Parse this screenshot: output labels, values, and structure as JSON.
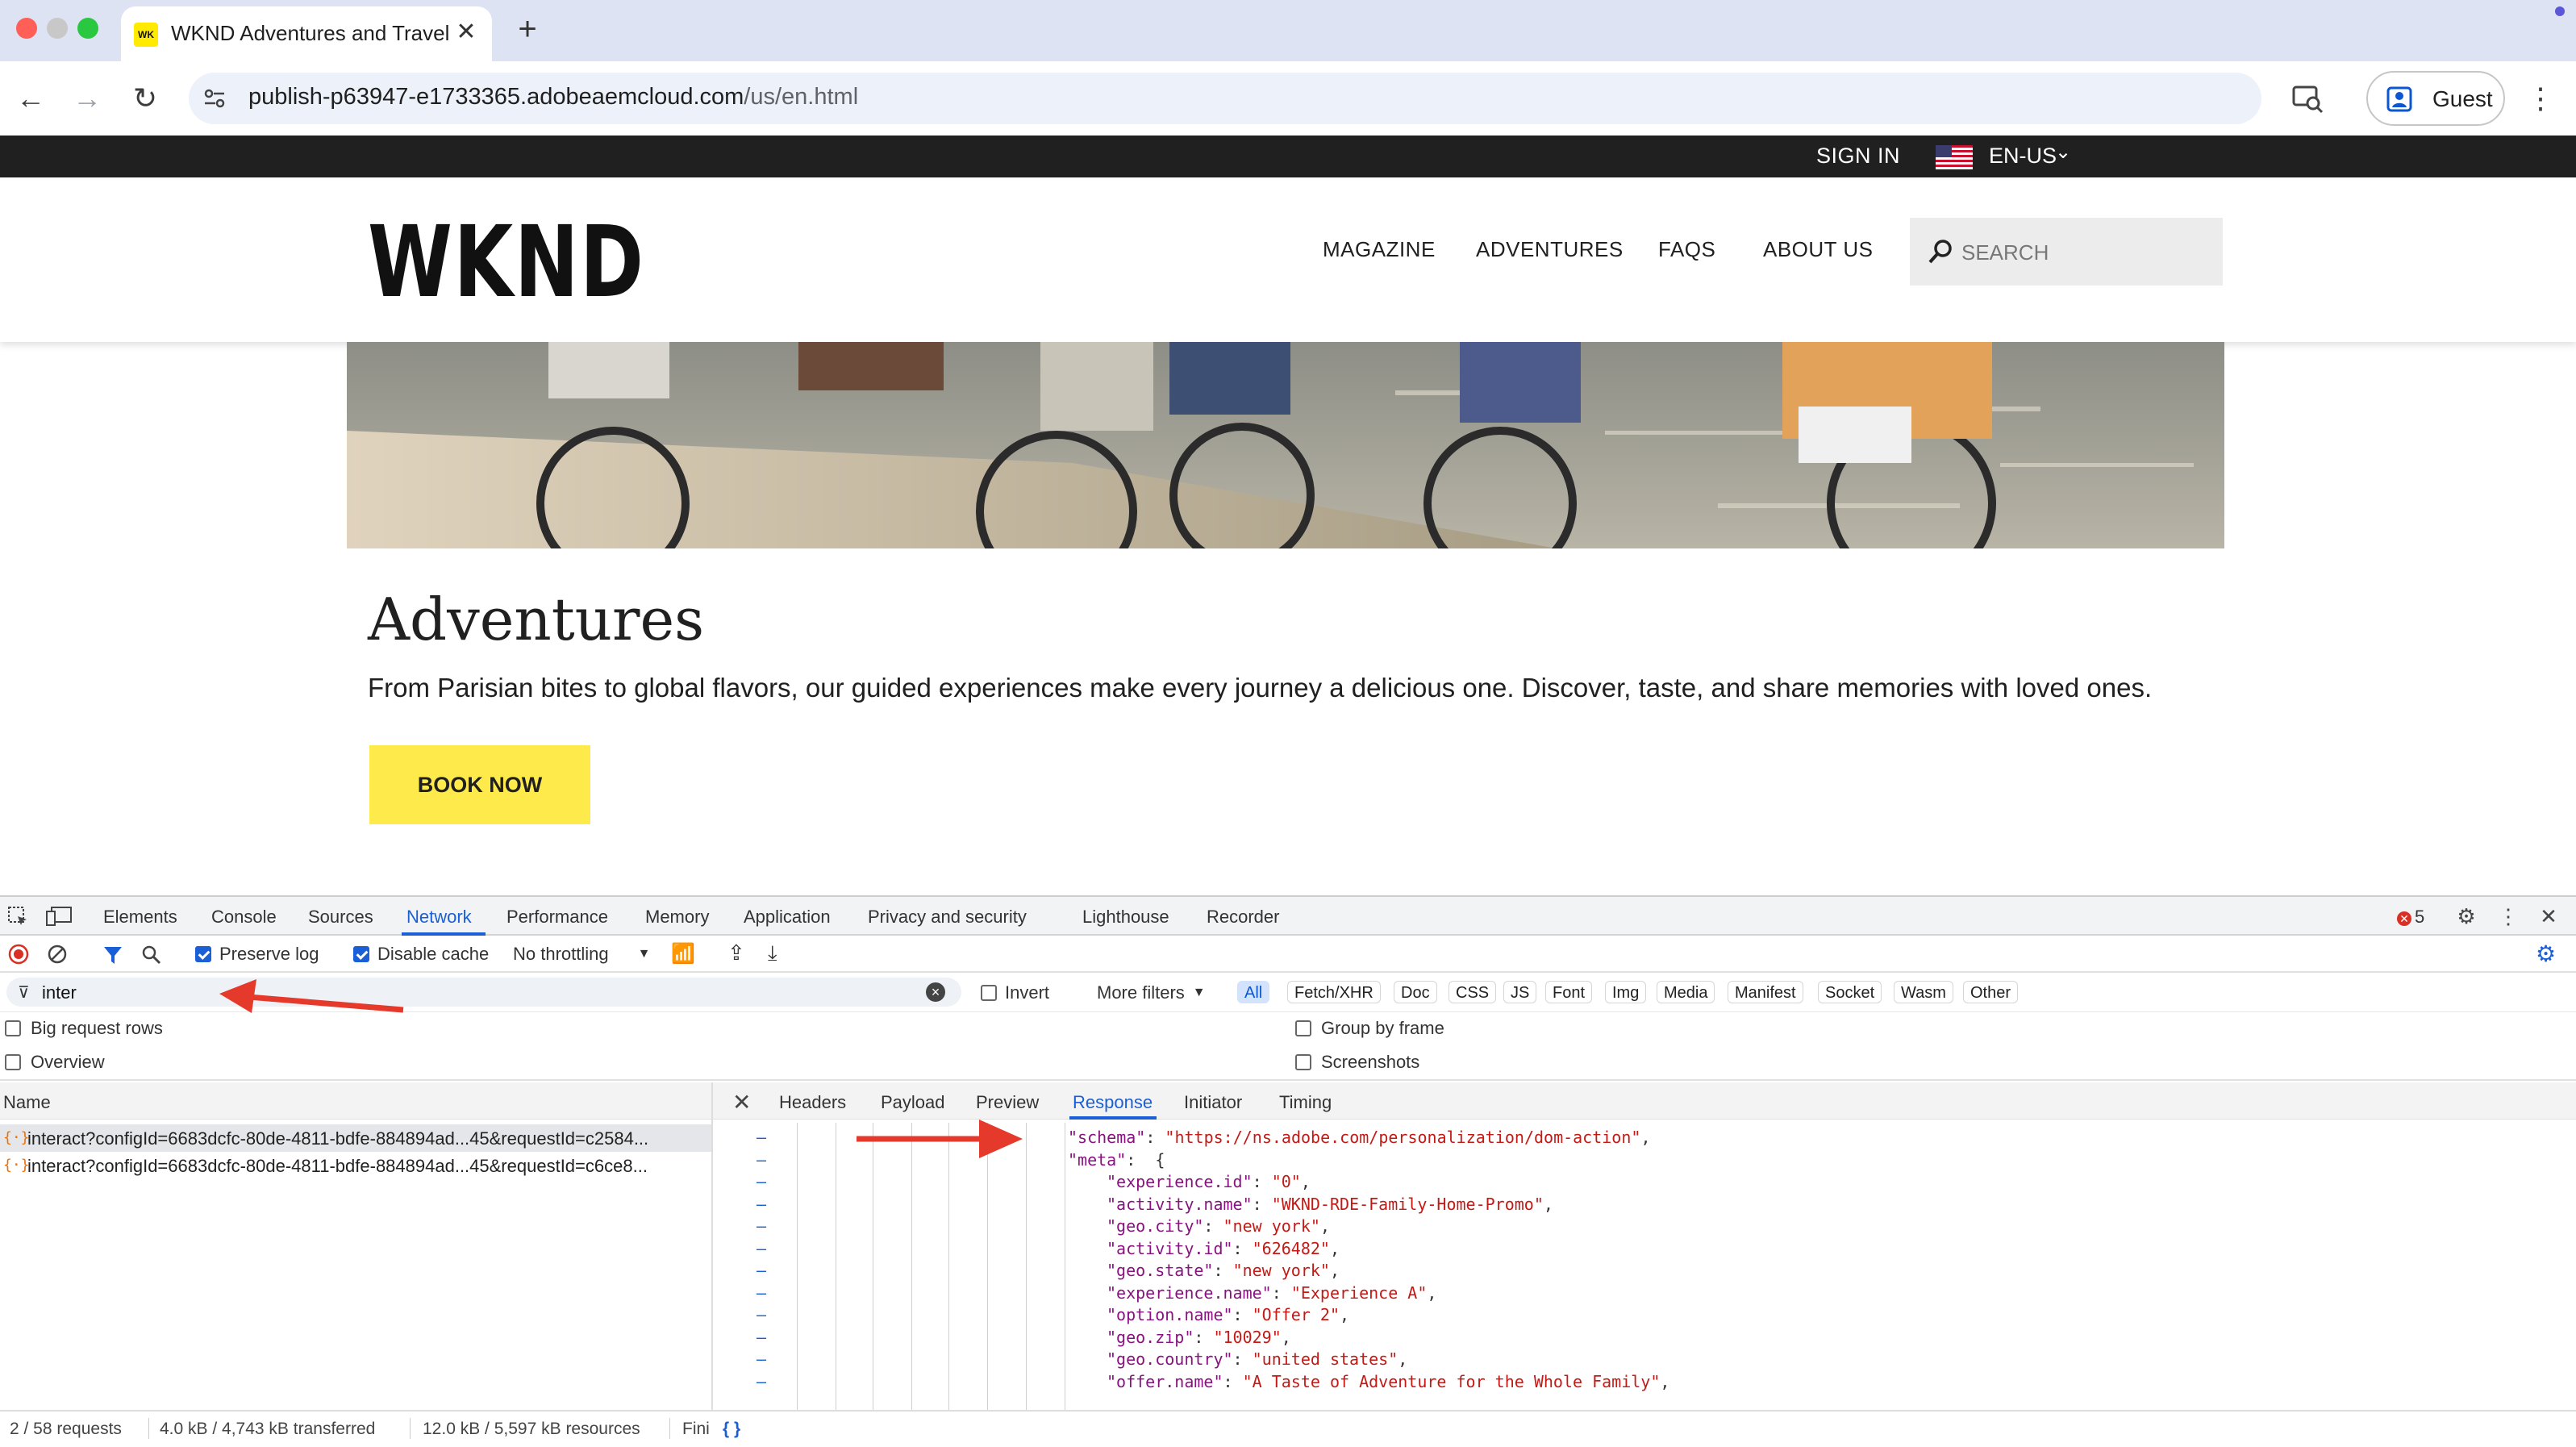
{
  "browser": {
    "tab": {
      "favicon_text": "WK",
      "title": "WKND Adventures and Travel",
      "close": "✕"
    },
    "new_tab": "+",
    "url_host": "publish-p63947-e1733365.adobeaemcloud.com",
    "url_path": "/us/en.html",
    "profile_label": "Guest",
    "menu": "⋮"
  },
  "site": {
    "topbar": {
      "sign_in": "SIGN IN",
      "language": "EN-US"
    },
    "logo": "WKND",
    "nav": [
      "MAGAZINE",
      "ADVENTURES",
      "FAQS",
      "ABOUT US"
    ],
    "search_placeholder": "SEARCH",
    "page_title": "Adventures",
    "description": "From Parisian bites to global flavors, our guided experiences make every journey a delicious one. Discover, taste, and share memories with loved ones.",
    "cta": "BOOK NOW"
  },
  "devtools": {
    "tabs": [
      "Elements",
      "Console",
      "Sources",
      "Network",
      "Performance",
      "Memory",
      "Application",
      "Privacy and security",
      "Lighthouse",
      "Recorder"
    ],
    "active_tab": "Network",
    "error_count": "5",
    "toolbar": {
      "preserve_log": "Preserve log",
      "disable_cache": "Disable cache",
      "throttling": "No throttling"
    },
    "filter": {
      "value": "inter",
      "invert": "Invert",
      "more_filters": "More filters"
    },
    "type_chips": [
      "All",
      "Fetch/XHR",
      "Doc",
      "CSS",
      "JS",
      "Font",
      "Img",
      "Media",
      "Manifest",
      "Socket",
      "Wasm",
      "Other"
    ],
    "options": {
      "big_rows": "Big request rows",
      "overview": "Overview",
      "group_by_frame": "Group by frame",
      "screenshots": "Screenshots"
    },
    "requests": {
      "header": "Name",
      "rows": [
        "interact?configId=6683dcfc-80de-4811-bdfe-884894ad...45&requestId=c2584...",
        "interact?configId=6683dcfc-80de-4811-bdfe-884894ad...45&requestId=c6ce8..."
      ]
    },
    "detail_tabs": [
      "Headers",
      "Payload",
      "Preview",
      "Response",
      "Initiator",
      "Timing"
    ],
    "detail_active": "Response",
    "response_lines": [
      {
        "indent": 0,
        "key": "\"schema\"",
        "value": "\"https://ns.adobe.com/personalization/dom-action\"",
        "tail": ","
      },
      {
        "indent": 0,
        "key": "\"meta\"",
        "value": "",
        "tail": " {"
      },
      {
        "indent": 1,
        "key": "\"experience.id\"",
        "value": "\"0\"",
        "tail": ","
      },
      {
        "indent": 1,
        "key": "\"activity.name\"",
        "value": "\"WKND-RDE-Family-Home-Promo\"",
        "tail": ","
      },
      {
        "indent": 1,
        "key": "\"geo.city\"",
        "value": "\"new york\"",
        "tail": ","
      },
      {
        "indent": 1,
        "key": "\"activity.id\"",
        "value": "\"626482\"",
        "tail": ","
      },
      {
        "indent": 1,
        "key": "\"geo.state\"",
        "value": "\"new york\"",
        "tail": ","
      },
      {
        "indent": 1,
        "key": "\"experience.name\"",
        "value": "\"Experience A\"",
        "tail": ","
      },
      {
        "indent": 1,
        "key": "\"option.name\"",
        "value": "\"Offer 2\"",
        "tail": ","
      },
      {
        "indent": 1,
        "key": "\"geo.zip\"",
        "value": "\"10029\"",
        "tail": ","
      },
      {
        "indent": 1,
        "key": "\"geo.country\"",
        "value": "\"united states\"",
        "tail": ","
      },
      {
        "indent": 1,
        "key": "\"offer.name\"",
        "value": "\"A Taste of Adventure for the Whole Family\"",
        "tail": ","
      }
    ],
    "status": {
      "requests": "2 / 58 requests",
      "transferred": "4.0 kB / 4,743 kB transferred",
      "resources": "12.0 kB / 5,597 kB resources",
      "finish": "Fini",
      "pretty_print": "{ }"
    }
  },
  "colors": {
    "accent_yellow": "#ffea4c",
    "devtools_blue": "#1a5fd6",
    "annotation_red": "#e5392b"
  }
}
